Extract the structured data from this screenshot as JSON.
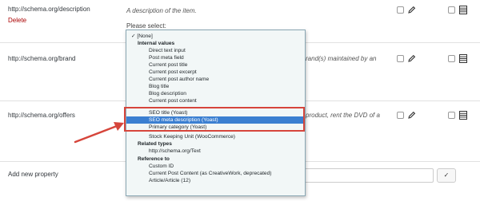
{
  "colors": {
    "delete": "#aa0000",
    "highlight_box": "#d6453b",
    "selected_option_bg": "#3b7fd1"
  },
  "rows": [
    {
      "property": "http://schema.org/description",
      "delete_label": "Delete",
      "description": "A description of the item.",
      "prompt": "Please select:"
    },
    {
      "property": "http://schema.org/brand",
      "description_fragment": "rand(s) maintained by an"
    },
    {
      "property": "http://schema.org/offers",
      "description_fragment": "product, rent the DVD of a"
    }
  ],
  "add_new": {
    "label": "Add new property",
    "button_label": "✓",
    "button_icon": "checkmark-icon"
  },
  "dropdown": {
    "none_option": "✓ [None]",
    "group_internal": "Internal values",
    "internal": [
      "Direct text input",
      "Post meta field",
      "Current post title",
      "Current post excerpt",
      "Current post author name",
      "Blog title",
      "Blog description",
      "Current post content",
      "SEO title (Yoast)",
      "SEO meta description (Yoast)",
      "Primary category (Yoast)",
      "Stock Keeping Unit (WooCommerce)"
    ],
    "group_related": "Related types",
    "related": [
      "http://schema.org/Text"
    ],
    "group_reference": "Reference to",
    "reference": [
      "Custom ID",
      "Current Post Content (as CreativeWork, deprecated)",
      "Article/Article (12)"
    ],
    "selected": "SEO meta description (Yoast)"
  }
}
